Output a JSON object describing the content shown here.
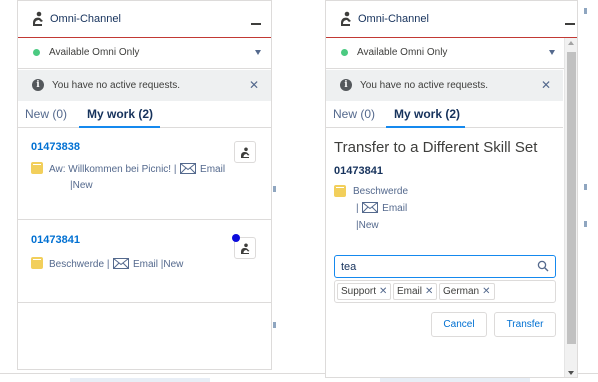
{
  "colors": {
    "accent": "#0070d2",
    "header_border": "#c23934",
    "status_available": "#4bca81",
    "case_icon": "#f2cf5b",
    "notification_dot": "#0c0cdc"
  },
  "left_panel": {
    "header": {
      "title": "Omni-Channel",
      "icon": "omni-channel-icon"
    },
    "status": {
      "text": "Available Omni Only"
    },
    "alert": {
      "text": "You have no active requests."
    },
    "tabs": {
      "new_label": "New (0)",
      "mywork_label": "My work (2)"
    },
    "items": [
      {
        "id": "01473838",
        "subject": "Aw: Willkommen bei Picnic!",
        "sep1": "|",
        "channel": "Email",
        "sep2": "|",
        "status": "New"
      },
      {
        "id": "01473841",
        "subject": "Beschwerde",
        "sep1": "|",
        "channel": "Email",
        "sep2": "|",
        "status": "New"
      }
    ]
  },
  "right_panel": {
    "header": {
      "title": "Omni-Channel",
      "icon": "omni-channel-icon"
    },
    "status": {
      "text": "Available Omni Only"
    },
    "alert": {
      "text": "You have no active requests."
    },
    "tabs": {
      "new_label": "New (0)",
      "mywork_label": "My work (2)"
    },
    "transfer": {
      "title": "Transfer to a Different Skill Set",
      "id": "01473841",
      "subject": "Beschwerde",
      "sep1": "|",
      "channel": "Email",
      "sep2": "|",
      "status": "New",
      "search_value": "tea",
      "pills": [
        "Support",
        "Email",
        "German"
      ],
      "cancel_label": "Cancel",
      "transfer_label": "Transfer"
    }
  }
}
